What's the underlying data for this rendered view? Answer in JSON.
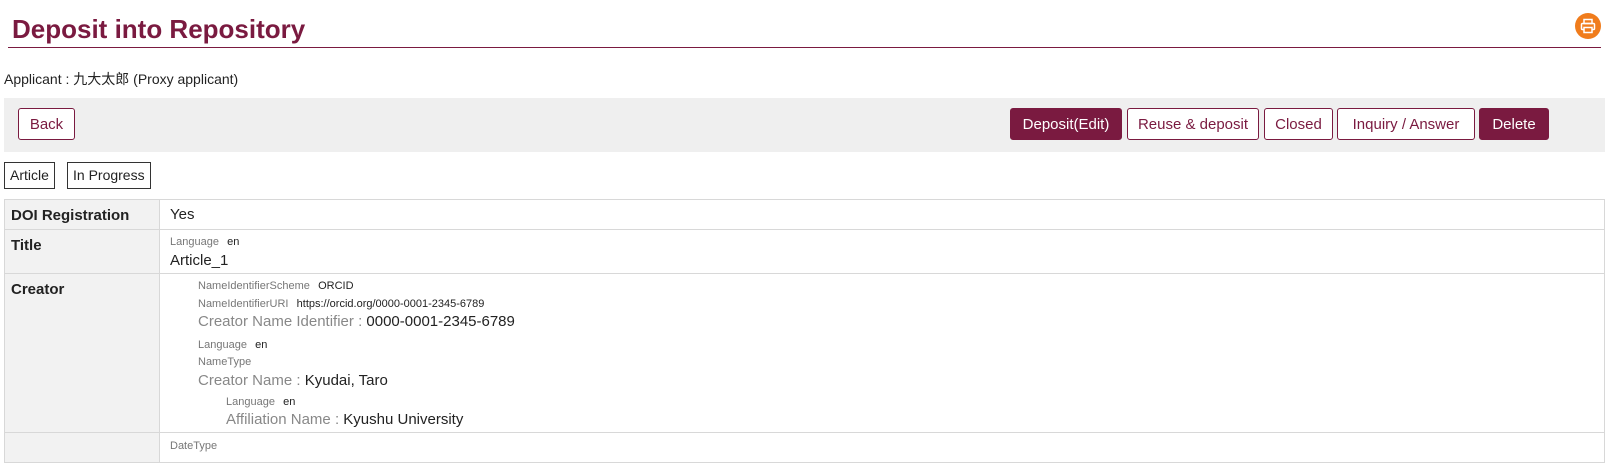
{
  "header": {
    "title": "Deposit into Repository",
    "print_icon": "printer-icon"
  },
  "applicant": {
    "text": "Applicant : 九大太郎 (Proxy applicant)"
  },
  "toolbar": {
    "back": "Back",
    "deposit_edit": "Deposit(Edit)",
    "reuse_deposit": "Reuse & deposit",
    "closed": "Closed",
    "inquiry": "Inquiry / Answer",
    "delete": "Delete"
  },
  "tags": {
    "type": "Article",
    "status": "In Progress"
  },
  "rows": {
    "doi": {
      "label": "DOI Registration",
      "value": "Yes"
    },
    "title": {
      "label": "Title",
      "language_label": "Language",
      "language": "en",
      "value": "Article_1"
    },
    "creator": {
      "label": "Creator",
      "scheme_label": "NameIdentifierScheme",
      "scheme": "ORCID",
      "uri_label": "NameIdentifierURI",
      "uri": "https://orcid.org/0000-0001-2345-6789",
      "identifier_label": "Creator Name Identifier :",
      "identifier": "0000-0001-2345-6789",
      "name_language_label": "Language",
      "name_language": "en",
      "nametype_label": "NameType",
      "name_label": "Creator Name :",
      "name": "Kyudai, Taro",
      "aff_language_label": "Language",
      "aff_language": "en",
      "affiliation_label": "Affiliation Name :",
      "affiliation": "Kyushu University"
    },
    "next": {
      "partial_label": "DateType"
    }
  },
  "colors": {
    "brand": "#7a1a40",
    "accent": "#f07c1c",
    "key_bg": "#f2f2f2"
  }
}
